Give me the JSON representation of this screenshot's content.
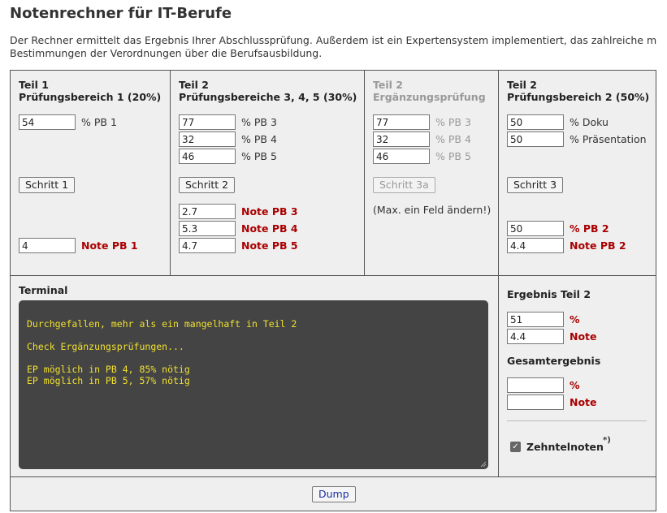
{
  "page": {
    "title": "Notenrechner für IT-Berufe",
    "intro_line1": "Der Rechner ermittelt das Ergebnis Ihrer Abschlussprüfung. Außerdem ist ein Expertensystem implementiert, das zahlreiche m",
    "intro_line2": "Bestimmungen der Verordnungen über die Berufsausbildung."
  },
  "teil1": {
    "head1": "Teil 1",
    "head2": "Prüfungsbereich 1 (20%)",
    "pb1_value": "54",
    "pb1_label": "% PB 1",
    "button": "Schritt 1",
    "note_value": "4",
    "note_label": "Note PB 1"
  },
  "teil2a": {
    "head1": "Teil 2",
    "head2": "Prüfungsbereiche 3, 4, 5 (30%)",
    "pb3_value": "77",
    "pb3_label": "% PB 3",
    "pb4_value": "32",
    "pb4_label": "% PB 4",
    "pb5_value": "46",
    "pb5_label": "% PB 5",
    "button": "Schritt 2",
    "note3_value": "2.7",
    "note3_label": "Note PB 3",
    "note4_value": "5.3",
    "note4_label": "Note PB 4",
    "note5_value": "4.7",
    "note5_label": "Note PB 5"
  },
  "ergaenzung": {
    "head1": "Teil 2",
    "head2": "Ergänzungsprüfung",
    "pb3_value": "77",
    "pb3_label": "% PB 3",
    "pb4_value": "32",
    "pb4_label": "% PB 4",
    "pb5_value": "46",
    "pb5_label": "% PB 5",
    "button": "Schritt 3a",
    "hint": "(Max. ein Feld ändern!)"
  },
  "teil2b": {
    "head1": "Teil 2",
    "head2": "Prüfungsbereich 2 (50%)",
    "doku_value": "50",
    "doku_label": "% Doku",
    "praes_value": "50",
    "praes_label": "% Präsentation",
    "button": "Schritt 3",
    "pb2_value": "50",
    "pb2_label": "% PB 2",
    "note_value": "4.4",
    "note_label": "Note PB 2"
  },
  "terminal": {
    "title": "Terminal",
    "lines": [
      "Durchgefallen, mehr als ein mangelhaft in Teil 2",
      "",
      "Check Ergänzungsprüfungen...",
      "",
      "EP möglich in PB 4, 85% nötig",
      "EP möglich in PB 5, 57% nötig"
    ]
  },
  "result": {
    "teil2_title": "Ergebnis Teil 2",
    "teil2_percent_value": "51",
    "percent_label": "%",
    "teil2_note_value": "4.4",
    "note_label": "Note",
    "gesamt_title": "Gesamtergebnis",
    "gesamt_percent_value": "",
    "gesamt_note_value": "",
    "zehntel_label": "Zehntelnoten",
    "zehntel_mark": "*)",
    "zehntel_checked": true
  },
  "footer": {
    "dump_button": "Dump"
  }
}
